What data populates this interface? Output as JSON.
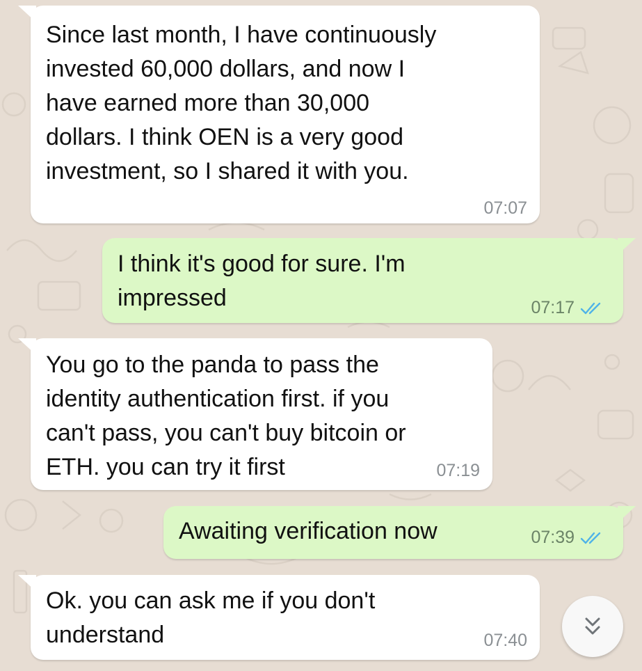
{
  "messages": [
    {
      "direction": "incoming",
      "text": "Since last month, I have continuously\ninvested 60,000 dollars, and now I\nhave earned more than 30,000\ndollars. I think OEN is a very good\ninvestment, so I shared it with you.",
      "time": "07:07"
    },
    {
      "direction": "outgoing",
      "text": "I think it's good for sure. I'm\nimpressed",
      "time": "07:17",
      "status": "read"
    },
    {
      "direction": "incoming",
      "text": "You go to the panda to pass the\nidentity authentication first. if you\ncan't pass, you can't buy bitcoin or\nETH. you can try it first",
      "time": "07:19"
    },
    {
      "direction": "outgoing",
      "text": "Awaiting verification now",
      "time": "07:39",
      "status": "read"
    },
    {
      "direction": "incoming",
      "text": "Ok. you can ask me if you don't\nunderstand",
      "time": "07:40"
    }
  ],
  "colors": {
    "wallpaper": "#e7ddd3",
    "incoming_bubble": "#ffffff",
    "outgoing_bubble": "#dcf8c6",
    "read_ticks": "#4fb3e8"
  },
  "icons": {
    "read_receipt": "double-check-icon",
    "scroll_button": "double-chevron-down-icon"
  }
}
